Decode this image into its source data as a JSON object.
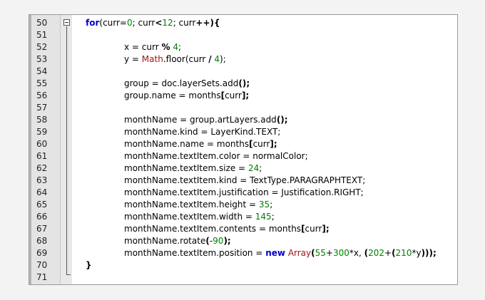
{
  "lines": [
    {
      "num": "50",
      "indent": 0,
      "tokens": [
        {
          "t": "for",
          "c": "kw"
        },
        {
          "t": "(curr=",
          "c": ""
        },
        {
          "t": "0",
          "c": "num"
        },
        {
          "t": "; curr",
          "c": ""
        },
        {
          "t": "<",
          "c": "op"
        },
        {
          "t": "12",
          "c": "num"
        },
        {
          "t": "; curr",
          "c": ""
        },
        {
          "t": "++",
          "c": "op"
        },
        {
          "t": "){",
          "c": "op"
        }
      ]
    },
    {
      "num": "51",
      "indent": 0,
      "tokens": []
    },
    {
      "num": "52",
      "indent": 2,
      "tokens": [
        {
          "t": "x = curr ",
          "c": ""
        },
        {
          "t": "%",
          "c": "op"
        },
        {
          "t": " ",
          "c": ""
        },
        {
          "t": "4",
          "c": "num"
        },
        {
          "t": ";",
          "c": ""
        }
      ]
    },
    {
      "num": "53",
      "indent": 2,
      "tokens": [
        {
          "t": "y = ",
          "c": ""
        },
        {
          "t": "Math",
          "c": "cls"
        },
        {
          "t": ".floor(curr ",
          "c": ""
        },
        {
          "t": "/",
          "c": "op"
        },
        {
          "t": " ",
          "c": ""
        },
        {
          "t": "4",
          "c": "num"
        },
        {
          "t": ");",
          "c": ""
        }
      ]
    },
    {
      "num": "54",
      "indent": 0,
      "tokens": []
    },
    {
      "num": "55",
      "indent": 2,
      "tokens": [
        {
          "t": "group = doc.layerSets.add",
          "c": ""
        },
        {
          "t": "();",
          "c": "op"
        }
      ]
    },
    {
      "num": "56",
      "indent": 2,
      "tokens": [
        {
          "t": "group.name = months",
          "c": ""
        },
        {
          "t": "[",
          "c": "op"
        },
        {
          "t": "curr",
          "c": ""
        },
        {
          "t": "];",
          "c": "op"
        }
      ]
    },
    {
      "num": "57",
      "indent": 0,
      "tokens": []
    },
    {
      "num": "58",
      "indent": 2,
      "tokens": [
        {
          "t": "monthName = group.artLayers.add",
          "c": ""
        },
        {
          "t": "();",
          "c": "op"
        }
      ]
    },
    {
      "num": "59",
      "indent": 2,
      "tokens": [
        {
          "t": "monthName.kind = LayerKind.TEXT;",
          "c": ""
        }
      ]
    },
    {
      "num": "60",
      "indent": 2,
      "tokens": [
        {
          "t": "monthName.name = months",
          "c": ""
        },
        {
          "t": "[",
          "c": "op"
        },
        {
          "t": "curr",
          "c": ""
        },
        {
          "t": "];",
          "c": "op"
        }
      ]
    },
    {
      "num": "61",
      "indent": 2,
      "tokens": [
        {
          "t": "monthName.textItem.color = normalColor;",
          "c": ""
        }
      ]
    },
    {
      "num": "62",
      "indent": 2,
      "tokens": [
        {
          "t": "monthName.textItem.size = ",
          "c": ""
        },
        {
          "t": "24",
          "c": "num"
        },
        {
          "t": ";",
          "c": ""
        }
      ]
    },
    {
      "num": "63",
      "indent": 2,
      "tokens": [
        {
          "t": "monthName.textItem.kind = TextType.PARAGRAPHTEXT;",
          "c": ""
        }
      ]
    },
    {
      "num": "64",
      "indent": 2,
      "tokens": [
        {
          "t": "monthName.textItem.justification = Justification.RIGHT;",
          "c": ""
        }
      ]
    },
    {
      "num": "65",
      "indent": 2,
      "tokens": [
        {
          "t": "monthName.textItem.height = ",
          "c": ""
        },
        {
          "t": "35",
          "c": "num"
        },
        {
          "t": ";",
          "c": ""
        }
      ]
    },
    {
      "num": "66",
      "indent": 2,
      "tokens": [
        {
          "t": "monthName.textItem.width = ",
          "c": ""
        },
        {
          "t": "145",
          "c": "num"
        },
        {
          "t": ";",
          "c": ""
        }
      ]
    },
    {
      "num": "67",
      "indent": 2,
      "tokens": [
        {
          "t": "monthName.textItem.contents = months",
          "c": ""
        },
        {
          "t": "[",
          "c": "op"
        },
        {
          "t": "curr",
          "c": ""
        },
        {
          "t": "];",
          "c": "op"
        }
      ]
    },
    {
      "num": "68",
      "indent": 2,
      "tokens": [
        {
          "t": "monthName.rotate",
          "c": ""
        },
        {
          "t": "(",
          "c": "op"
        },
        {
          "t": "-",
          "c": ""
        },
        {
          "t": "90",
          "c": "num"
        },
        {
          "t": ");",
          "c": "op"
        }
      ]
    },
    {
      "num": "69",
      "indent": 2,
      "tokens": [
        {
          "t": "monthName.textItem.position = ",
          "c": ""
        },
        {
          "t": "new",
          "c": "kw"
        },
        {
          "t": " ",
          "c": ""
        },
        {
          "t": "Array",
          "c": "cls"
        },
        {
          "t": "(",
          "c": "op"
        },
        {
          "t": "55",
          "c": "num"
        },
        {
          "t": "+",
          "c": ""
        },
        {
          "t": "300",
          "c": "num"
        },
        {
          "t": "*x, ",
          "c": ""
        },
        {
          "t": "(",
          "c": "op"
        },
        {
          "t": "202",
          "c": "num"
        },
        {
          "t": "+",
          "c": ""
        },
        {
          "t": "(",
          "c": "op"
        },
        {
          "t": "210",
          "c": "num"
        },
        {
          "t": "*y",
          "c": ""
        },
        {
          "t": ")));",
          "c": "op"
        }
      ]
    },
    {
      "num": "70",
      "indent": 0,
      "tokens": [
        {
          "t": "}",
          "c": "op"
        }
      ]
    },
    {
      "num": "71",
      "indent": 0,
      "tokens": []
    }
  ],
  "colors": {
    "keyword": "#0000cc",
    "number": "#008000",
    "class": "#a31515",
    "gutter": "#e4e4e4"
  }
}
